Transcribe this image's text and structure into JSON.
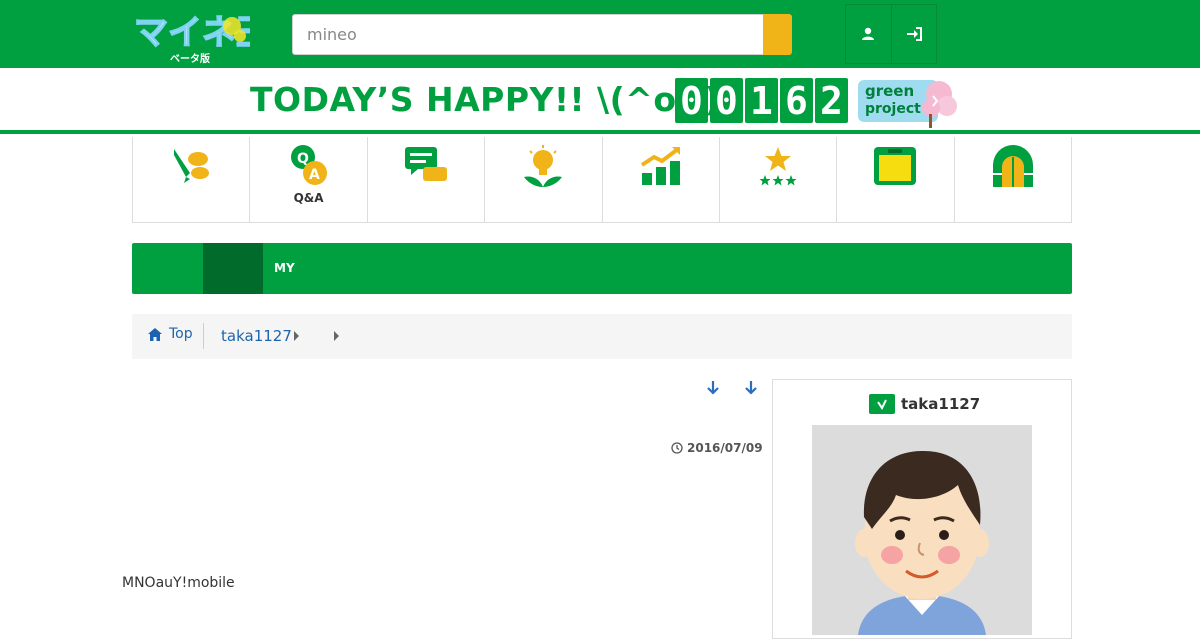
{
  "header": {
    "logo_text": "マイネ王",
    "logo_sub": "ベータ版",
    "search_value": "mineo",
    "profile_icon": "user-icon",
    "login_icon": "sign-in-icon"
  },
  "banner": {
    "happy_text": "TODAY’S HAPPY!! \\(^o^)/",
    "counter_digits": [
      "0",
      "0",
      "1",
      "6",
      "2"
    ],
    "green_project_line1": "green",
    "green_project_line2": "project"
  },
  "nav": {
    "items": [
      {
        "icon": "pen-chat-icon",
        "label": ""
      },
      {
        "icon": "qa-icon",
        "label": "Q&A"
      },
      {
        "icon": "message-icon",
        "label": ""
      },
      {
        "icon": "idea-bulb-icon",
        "label": ""
      },
      {
        "icon": "chart-growth-icon",
        "label": ""
      },
      {
        "icon": "star-rating-icon",
        "label": ""
      },
      {
        "icon": "folder-icon",
        "label": ""
      },
      {
        "icon": "gate-icon",
        "label": ""
      }
    ]
  },
  "greenbar": {
    "label": "MY"
  },
  "breadcrumb": {
    "top": "Top",
    "user": "taka1127"
  },
  "post": {
    "date": "2016/07/09",
    "body": "MNOauY!mobile"
  },
  "profile": {
    "name": "taka1127"
  },
  "colors": {
    "brand_green": "#00a040",
    "dark_green": "#006b2b",
    "accent_yellow": "#f0b418",
    "link_blue": "#1d64b0"
  }
}
